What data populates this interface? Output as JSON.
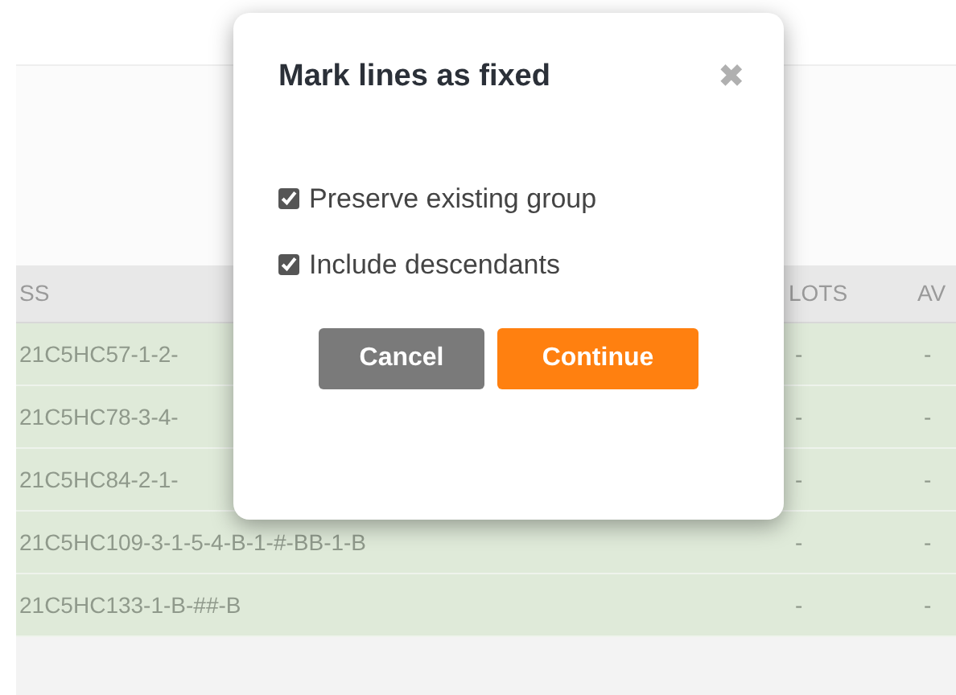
{
  "table": {
    "columns": [
      "SS",
      "LOTS",
      "AV"
    ],
    "rows": [
      {
        "cells": [
          "21C5HC57-1-2-",
          "-",
          "-"
        ]
      },
      {
        "cells": [
          "21C5HC78-3-4-",
          "-",
          "-"
        ]
      },
      {
        "cells": [
          "21C5HC84-2-1-",
          "-",
          "-"
        ]
      },
      {
        "cells": [
          "21C5HC109-3-1-5-4-B-1-#-BB-1-B",
          "-",
          "-"
        ]
      },
      {
        "cells": [
          "21C5HC133-1-B-##-B",
          "-",
          "-"
        ]
      }
    ]
  },
  "dialog": {
    "title": "Mark lines as fixed",
    "close": "✖",
    "options": [
      {
        "label": "Preserve existing group",
        "checked": true
      },
      {
        "label": "Include descendants",
        "checked": true
      }
    ],
    "buttons": [
      {
        "label": "Cancel",
        "kind": "secondary"
      },
      {
        "label": "Continue",
        "kind": "primary"
      }
    ]
  }
}
